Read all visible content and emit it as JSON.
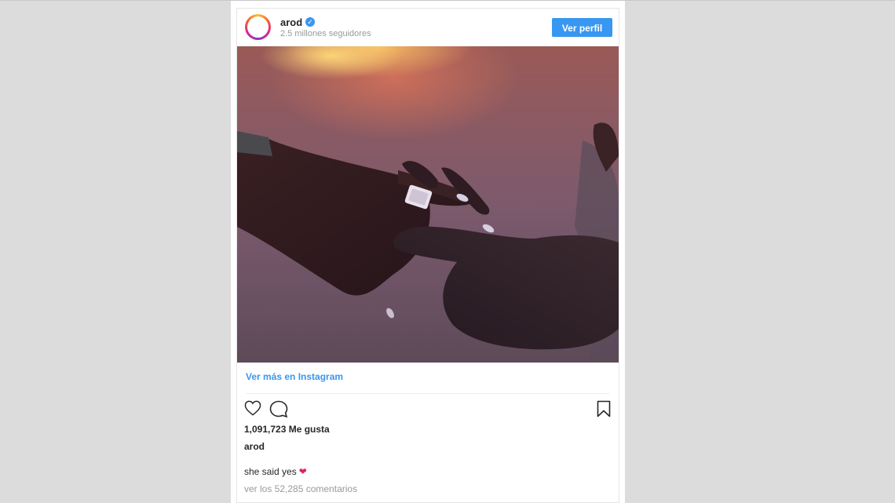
{
  "post": {
    "username": "arod",
    "followers": "2.5 millones seguidores",
    "view_profile_label": "Ver perfil",
    "view_more_label": "Ver más en Instagram",
    "likes": "1,091,723 Me gusta",
    "caption_user": "arod",
    "caption_text": "she said yes",
    "caption_emoji": "❤",
    "comments_link": "ver los 52,285 comentarios"
  },
  "icons": {
    "verified": "verified-badge-icon",
    "like": "heart-outline-icon",
    "comment": "speech-bubble-icon",
    "save": "bookmark-icon"
  },
  "colors": {
    "accent": "#3897f0",
    "text": "#262626",
    "muted": "#999999",
    "background": "#dcdcdc"
  }
}
